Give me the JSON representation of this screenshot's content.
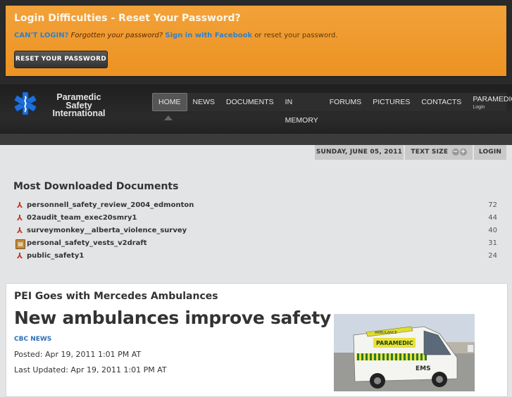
{
  "login": {
    "title": "Login Difficulties - Reset Your Password?",
    "cant_login": "CAN'T LOGIN?",
    "forgot": "Forgotten your password?",
    "facebook": "Sign in with Facebook",
    "rest": "or reset your password.",
    "reset_button": "RESET YOUR PASSWORD"
  },
  "logo": {
    "line1": "Paramedic",
    "line2": "Safety",
    "line3": "International"
  },
  "nav": {
    "items": [
      {
        "label": "HOME"
      },
      {
        "label": "NEWS"
      },
      {
        "label": "DOCUMENTS"
      },
      {
        "label": "IN MEMORY"
      },
      {
        "label": "FORUMS"
      },
      {
        "label": "PICTURES"
      },
      {
        "label": "CONTACTS"
      },
      {
        "label": "PARAMEDICS",
        "sub": "Login"
      }
    ]
  },
  "utility": {
    "date": "SUNDAY, JUNE 05, 2011",
    "text_size": "TEXT SIZE",
    "minus": "−",
    "plus": "+",
    "login": "LOGIN"
  },
  "downloads": {
    "title": "Most Downloaded Documents",
    "items": [
      {
        "name": "personnell_safety_review_2004_edmonton",
        "count": "72",
        "icon": "pdf-icon"
      },
      {
        "name": "02audit_team_exec20smry1",
        "count": "44",
        "icon": "pdf-icon"
      },
      {
        "name": "surveymonkey__alberta_violence_survey",
        "count": "40",
        "icon": "pdf-icon"
      },
      {
        "name": "personal_safety_vests_v2draft",
        "count": "31",
        "icon": "archive-icon"
      },
      {
        "name": "public_safety1",
        "count": "24",
        "icon": "pdf-icon"
      }
    ]
  },
  "article": {
    "kicker": "PEI Goes with Mercedes Ambulances",
    "headline": "New ambulances improve safety",
    "source": "CBC NEWS",
    "posted": "Posted: Apr 19, 2011 1:01 PM AT",
    "updated": "Last Updated: Apr 19, 2011 1:01 PM AT",
    "image_text": "PARAMEDIC",
    "image_text2": "AMBULANCE",
    "image_text3": "EMS"
  }
}
